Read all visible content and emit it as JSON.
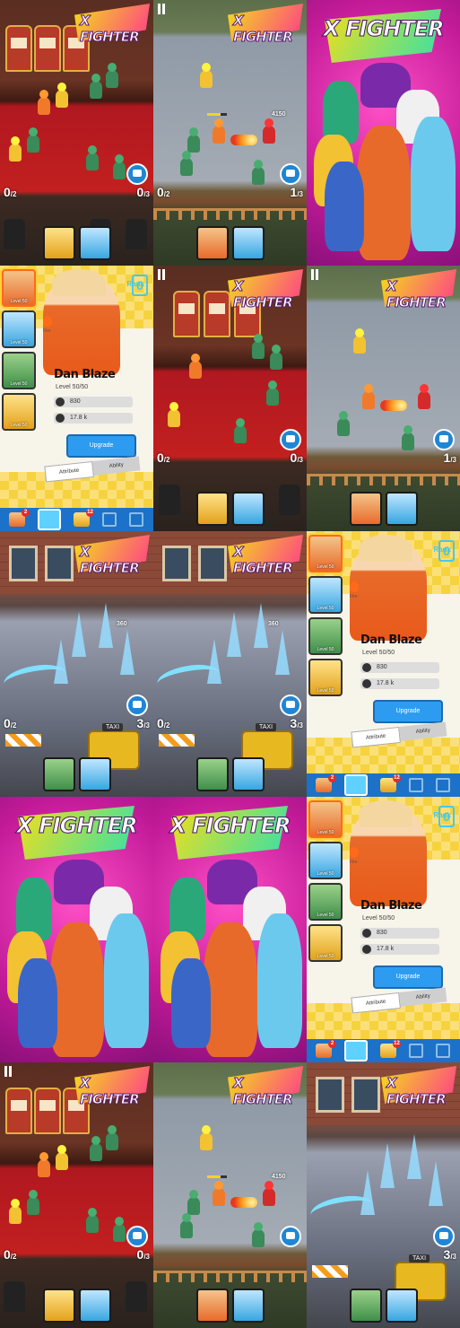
{
  "logo_text": "X FIGHTER",
  "poster_title": "X FIGHTER",
  "battles": {
    "casino": {
      "wave_left": "0",
      "wave_left_total": "/2",
      "wave_right": "0",
      "wave_right_total": "/3"
    },
    "street": {
      "wave_left": "0",
      "wave_left_total": "/2",
      "wave_right": "1",
      "wave_right_total": "/3",
      "hp_text": "4150"
    },
    "city": {
      "wave_left": "0",
      "wave_left_total": "/2",
      "wave_right": "3",
      "wave_right_total": "/3",
      "damage": "360",
      "taxi": "TAXI"
    }
  },
  "character_panel": {
    "name": "Dan Blaze",
    "level": "Level 50/50",
    "stat_power": "830",
    "stat_hp": "17.8 k",
    "upgrade_label": "Upgrade",
    "rank_label": "Rank",
    "rank_value": "0",
    "element_label": "Fire",
    "tab_attribute": "Attribute",
    "tab_ability": "Ability",
    "roster": [
      {
        "level": "Level 50"
      },
      {
        "level": "Level 50"
      },
      {
        "level": "Level 50"
      },
      {
        "level": "Level 50"
      }
    ],
    "badge_1": "2",
    "badge_2": "12"
  },
  "colors": {
    "accent_orange": "#e86a2a",
    "accent_blue": "#2d9cf0",
    "logo_yellow": "#f3df19",
    "poster_magenta": "#c21a98"
  }
}
